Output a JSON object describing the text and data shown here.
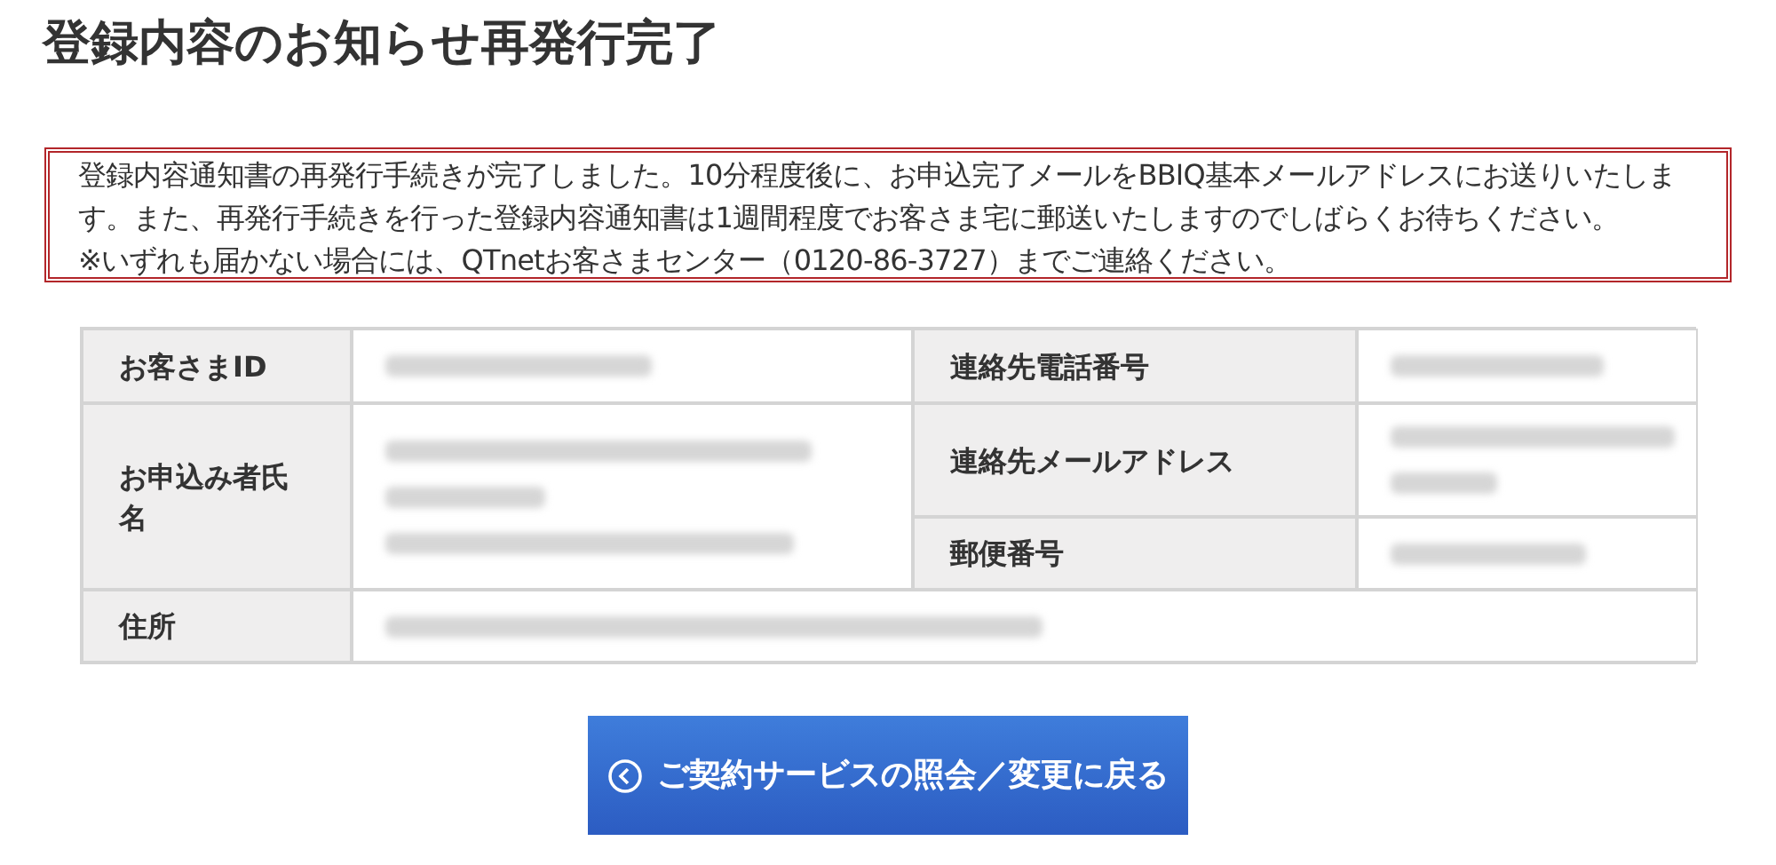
{
  "title": "登録内容のお知らせ再発行完了",
  "notice": [
    "登録内容通知書の再発行手続きが完了しました。10分程度後に、お申込完了メールをBBIQ基本メールアドレスにお送りいたします。また、再発行手続きを行った登録内容通知書は1週間程度でお客さま宅に郵送いたしますのでしばらくお待ちください。",
    "※いずれも届かない場合には、QTnetお客さまセンター（0120-86-3727）までご連絡ください。"
  ],
  "rows": [
    {
      "fields": [
        {
          "label": "お客さまID",
          "blurred": true
        },
        {
          "label": "連絡先電話番号",
          "blurred": true
        }
      ]
    },
    {
      "fields": [
        {
          "label": "お申込み者氏名",
          "blurred": true
        },
        {
          "label": "連絡先メールアドレス",
          "blurred": true
        }
      ]
    },
    {
      "fields": [
        {
          "label": "郵便番号",
          "blurred": true
        }
      ]
    },
    {
      "fields": [
        {
          "label": "住所",
          "blurred": true
        }
      ]
    }
  ],
  "back_button": {
    "label": "ご契約サービスの照会／変更に戻る"
  }
}
